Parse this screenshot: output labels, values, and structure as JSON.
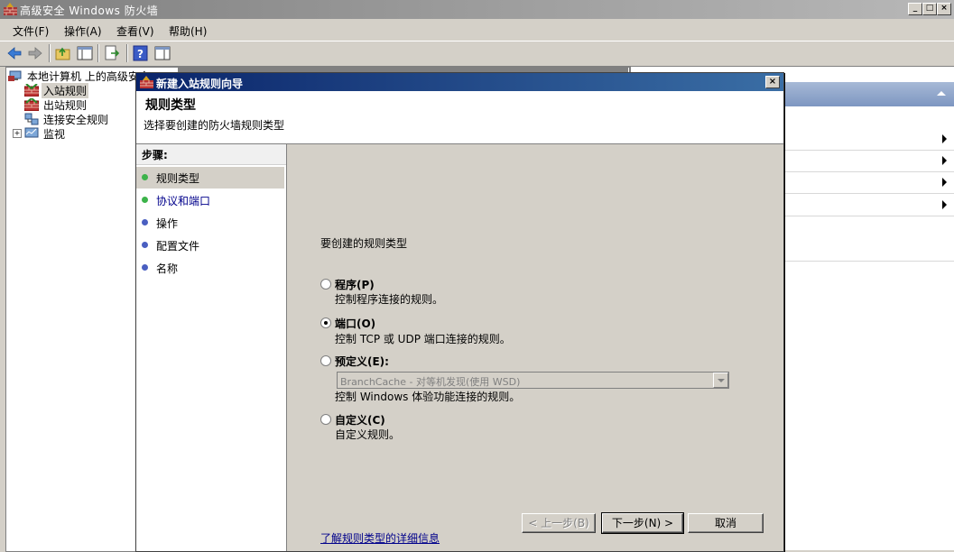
{
  "window": {
    "title": "高级安全 Windows 防火墙"
  },
  "menu": [
    "文件(F)",
    "操作(A)",
    "查看(V)",
    "帮助(H)"
  ],
  "tree": {
    "root": "本地计算机 上的高级安全",
    "items": [
      "入站规则",
      "出站规则",
      "连接安全规则",
      "监视"
    ],
    "expander": "+"
  },
  "wizard": {
    "title": "新建入站规则向导",
    "heading": "规则类型",
    "subheading": "选择要创建的防火墙规则类型",
    "steps_title": "步骤:",
    "steps": [
      "规则类型",
      "协议和端口",
      "操作",
      "配置文件",
      "名称"
    ],
    "prompt": "要创建的规则类型",
    "options": [
      {
        "label": "程序(P)",
        "desc": "控制程序连接的规则。"
      },
      {
        "label": "端口(O)",
        "desc": "控制 TCP 或 UDP 端口连接的规则。"
      },
      {
        "label": "预定义(E):",
        "desc": "控制 Windows 体验功能连接的规则。"
      },
      {
        "label": "自定义(C)",
        "desc": "自定义规则。"
      }
    ],
    "selected_option": "端口(O)",
    "predefined_value": "BranchCache - 对等机发现(使用 WSD)",
    "link": "了解规则类型的详细信息",
    "buttons": {
      "back": "< 上一步(B)",
      "next": "下一步(N) >",
      "cancel": "取消"
    }
  },
  "colors": {
    "titlebar_active": "#0a246a",
    "step_dot_done": "#3cb34a",
    "step_dot_todo": "#4a5fc1",
    "link": "#00008b"
  }
}
